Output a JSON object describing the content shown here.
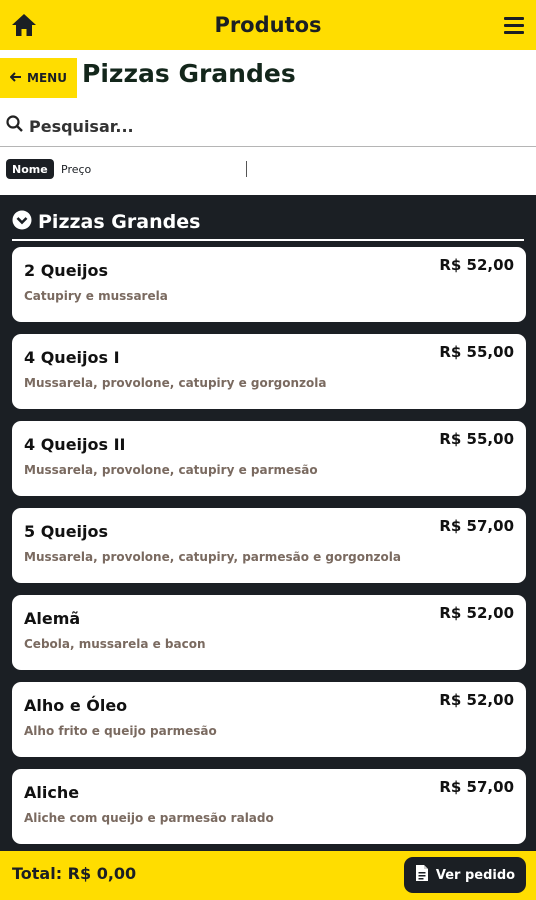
{
  "topbar": {
    "title": "Produtos",
    "home_icon": "home-icon",
    "menu_icon": "hamburger-icon"
  },
  "header": {
    "back_label": "MENU",
    "page_title": "Pizzas Grandes"
  },
  "search": {
    "placeholder": "Pesquisar..."
  },
  "sort": {
    "active": "Nome",
    "other": "Preço"
  },
  "section": {
    "title": "Pizzas Grandes"
  },
  "products": [
    {
      "name": "2 Queijos",
      "desc": "Catupiry e mussarela",
      "price": "R$ 52,00"
    },
    {
      "name": "4 Queijos I",
      "desc": "Mussarela, provolone, catupiry e gorgonzola",
      "price": "R$ 55,00"
    },
    {
      "name": "4 Queijos II",
      "desc": "Mussarela, provolone, catupiry e parmesão",
      "price": "R$ 55,00"
    },
    {
      "name": "5 Queijos",
      "desc": "Mussarela, provolone, catupiry, parmesão e gorgonzola",
      "price": "R$ 57,00"
    },
    {
      "name": "Alemã",
      "desc": "Cebola, mussarela e bacon",
      "price": "R$ 52,00"
    },
    {
      "name": "Alho e Óleo",
      "desc": "Alho frito e queijo parmesão",
      "price": "R$ 52,00"
    },
    {
      "name": "Aliche",
      "desc": "Aliche com queijo e parmesão ralado",
      "price": "R$ 57,00"
    }
  ],
  "footer": {
    "total": "Total: R$ 0,00",
    "order_label": "Ver pedido"
  },
  "colors": {
    "accent": "#ffdd00",
    "dark": "#1b1f24"
  }
}
